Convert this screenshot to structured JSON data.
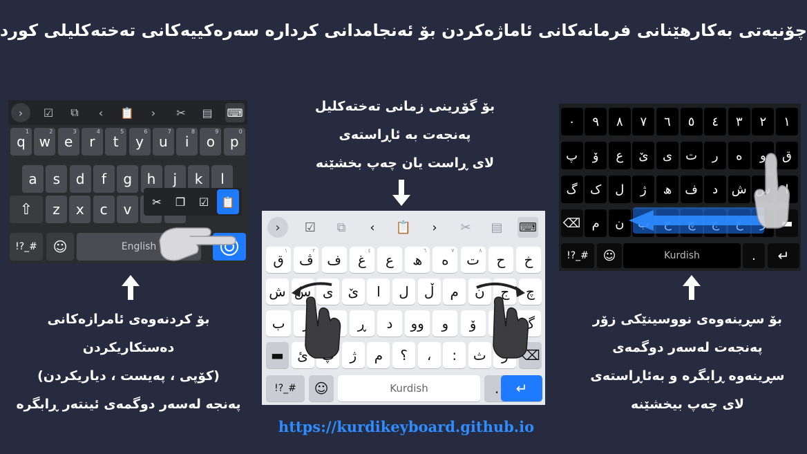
{
  "title": "چۆنیەتی بەکارهێنانی فرمانەکانی ئاماژەکردن بۆ ئەنجامدانی کردارە سەرەکییەکانی تەختەکلیلی کوردی",
  "captions": {
    "left": [
      "بۆ کردنەوەی ئامرازەکانی دەستکاریکردن",
      "(کۆپی ، پەیست ، دیاریکردن)",
      "پەنجە لەسەر دوگمەی ئینتەر ڕابگرە"
    ],
    "middle": [
      "بۆ گۆڕینی زمانی تەختەکلیل",
      "پەنجەت بە ئاڕاستەی",
      "لای ڕاست یان چەپ بخشێنە"
    ],
    "right": [
      "بۆ سڕینەوەی نووسینێکی زۆر",
      "پەنجەت لەسەر دوگمەی",
      "سڕینەوە ڕابگرە و بەئاڕاستەی",
      "لای چەپ بیخشێنە"
    ]
  },
  "url": "https://kurdikeyboard.github.io",
  "left_keyboard": {
    "toolbar_icons": [
      "chevron-right-icon",
      "select-all-icon",
      "copy-icon",
      "arrow-left-icon",
      "paste-icon",
      "arrow-right-icon",
      "cut-icon",
      "clipboard-icon",
      "keyboard-icon"
    ],
    "toolbar_glyphs": [
      "›",
      "☑",
      "⧉",
      "‹",
      "📋",
      "›",
      "✂",
      "▤",
      "⌨"
    ],
    "row1": [
      "q",
      "w",
      "e",
      "r",
      "t",
      "y",
      "u",
      "i",
      "o",
      "p"
    ],
    "row1_hints": [
      "1",
      "2",
      "3",
      "4",
      "5",
      "6",
      "7",
      "8",
      "9",
      "0"
    ],
    "row2": [
      "a",
      "s",
      "d",
      "f",
      "g",
      "h",
      "j",
      "k",
      "l"
    ],
    "row3": [
      "z",
      "x",
      "c",
      "v",
      "b",
      "n",
      "m"
    ],
    "shift_label": "⇧",
    "symbols_label": "!?_#",
    "emoji_label": "☺",
    "space_label": "English",
    "popup_icons": [
      "✂",
      "❐",
      "☑",
      "📋"
    ]
  },
  "middle_keyboard": {
    "toolbar_glyphs": [
      "›",
      "☑",
      "⧉",
      "‹",
      "📋",
      "›",
      "✂",
      "▤",
      "⌨"
    ],
    "row1": [
      "خ",
      "ح",
      "ت",
      "ە",
      "ھ",
      "ع",
      "غ",
      "ف",
      "ڤ",
      "ق"
    ],
    "row1_hints": [
      "",
      "",
      "٨",
      "٧",
      "٦",
      "",
      "٤",
      "",
      "٢",
      "١"
    ],
    "row2": [
      "چ",
      "ج",
      "ن",
      "م",
      "ڵ",
      "ل",
      "ا",
      "ێ",
      "ی",
      "س",
      "ش"
    ],
    "row3": [
      "گ",
      "ک",
      "ۆ",
      "و",
      "وو",
      "د",
      "ڕ",
      "ر",
      "ز",
      "ب"
    ],
    "row4": [
      "⌫",
      "ز",
      "ث",
      ":",
      "،",
      "؟",
      "م",
      "ژ",
      "پ",
      "ئ",
      "▬"
    ],
    "symbols_label": "!?_#",
    "emoji_label": "☺",
    "space_label": "Kurdish",
    "period_label": ".",
    "enter_label": "↵"
  },
  "right_keyboard": {
    "row1": [
      "١",
      "٢",
      "٣",
      "٤",
      "٥",
      "٦",
      "٧",
      "٨",
      "٩",
      "٠"
    ],
    "row2": [
      "ق",
      "و",
      "ە",
      "ر",
      "ت",
      "ی",
      "ێ",
      "ع",
      "ۆ",
      "پ"
    ],
    "row3": [
      "ا",
      "س",
      "ش",
      "د",
      "ف",
      "ھ",
      "ژ",
      "ل",
      "ک",
      "گ"
    ],
    "row4": [
      "▬",
      "ز",
      "خ",
      "ج",
      "چ",
      "ح",
      "ب",
      "ن",
      "م",
      "⌫"
    ],
    "symbols_label": "!?_#",
    "emoji_label": "☺",
    "space_label": "Kurdish",
    "period_label": ".",
    "enter_label": "↵"
  },
  "colors": {
    "background": "#262b3f",
    "accent_blue": "#2f8cff",
    "url": "#2f8cff"
  }
}
